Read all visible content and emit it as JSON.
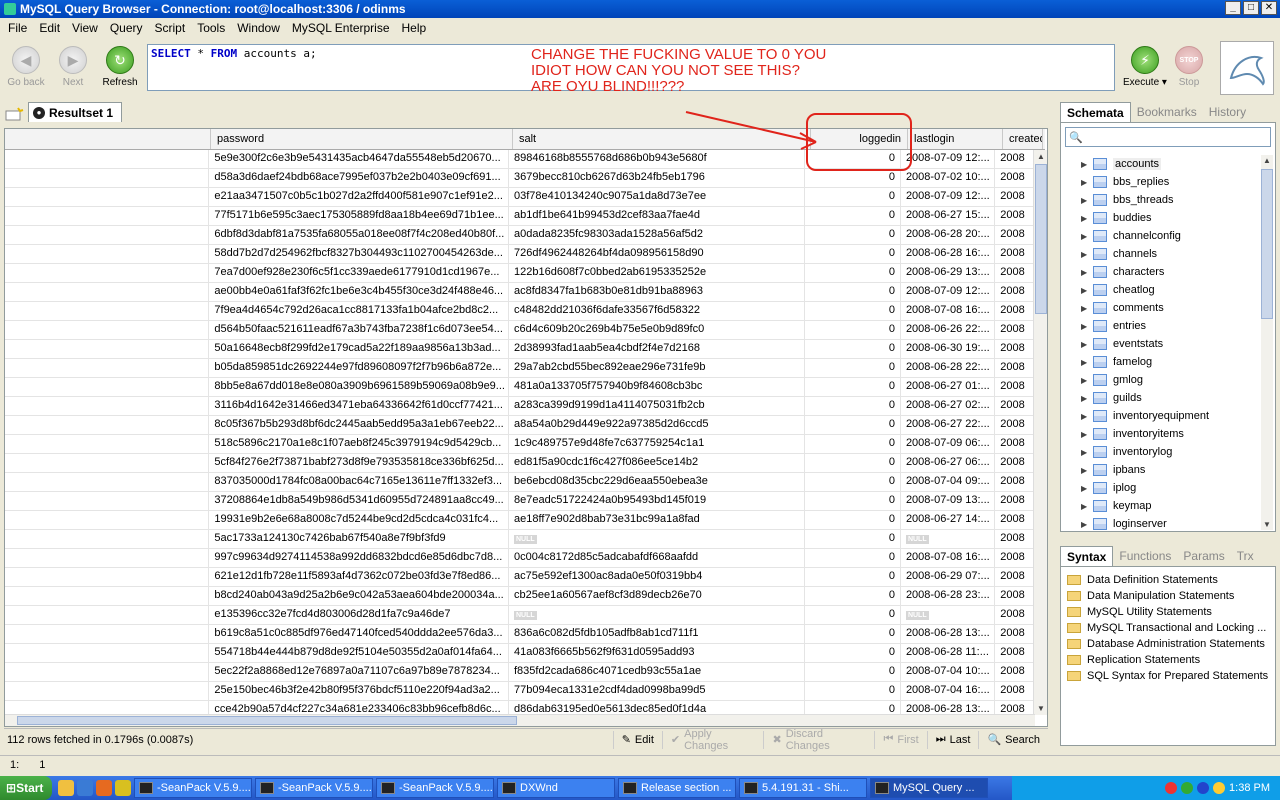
{
  "window": {
    "title": "MySQL Query Browser - Connection: root@localhost:3306 / odinms",
    "min": "_",
    "max": "□",
    "close": "✕"
  },
  "menu": [
    "File",
    "Edit",
    "View",
    "Query",
    "Script",
    "Tools",
    "Window",
    "MySQL Enterprise",
    "Help"
  ],
  "toolbar": {
    "goback": "Go back",
    "next": "Next",
    "refresh": "Refresh",
    "execute": "Execute",
    "stop": "Stop",
    "stop_icon_text": "STOP"
  },
  "query": {
    "kw1": "SELECT",
    "mid": " * ",
    "kw2": "FROM",
    "rest": " accounts a;"
  },
  "annotation": {
    "line1": "CHANGE THE FUCKING VALUE TO 0 YOU",
    "line2": "IDIOT HOW CAN YOU NOT SEE THIS?",
    "line3": "ARE OYU BLIND!!!???"
  },
  "result_tab": "Resultset 1",
  "columns": [
    "",
    "password",
    "salt",
    "loggedin",
    "lastlogin",
    "createda"
  ],
  "rows": [
    [
      "5e9e300f2c6e3b9e5431435acb4647da55548eb5d20670...",
      "89846168b8555768d686b0b943e5680f",
      "0",
      "2008-07-09 12:...",
      "2008"
    ],
    [
      "d58a3d6daef24bdb68ace7995ef037b2e2b0403e09cf691...",
      "3679becc810cb6267d63b24fb5eb1796",
      "0",
      "2008-07-02 10:...",
      "2008"
    ],
    [
      "e21aa3471507c0b5c1b027d2a2ffd400f581e907c1ef91e2...",
      "03f78e410134240c9075a1da8d73e7ee",
      "0",
      "2008-07-09 12:...",
      "2008"
    ],
    [
      "77f5171b6e595c3aec175305889fd8aa18b4ee69d71b1ee...",
      "ab1df1be641b99453d2cef83aa7fae4d",
      "0",
      "2008-06-27 15:...",
      "2008"
    ],
    [
      "6dbf8d3dabf81a7535fa68055a018ee08f7f4c208ed40b80f...",
      "a0dada8235fc98303ada1528a56af5d2",
      "0",
      "2008-06-28 20:...",
      "2008"
    ],
    [
      "58dd7b2d7d254962fbcf8327b304493c1102700454263de...",
      "726df4962448264bf4da098956158d90",
      "0",
      "2008-06-28 16:...",
      "2008"
    ],
    [
      "7ea7d00ef928e230f6c5f1cc339aede6177910d1cd1967e...",
      "122b16d608f7c0bbed2ab6195335252e",
      "0",
      "2008-06-29 13:...",
      "2008"
    ],
    [
      "ae00bb4e0a61faf3f62fc1be6e3c4b455f30ce3d24f488e46...",
      "ac8fd8347fa1b683b0e81db91ba88963",
      "0",
      "2008-07-09 12:...",
      "2008"
    ],
    [
      "7f9ea4d4654c792d26aca1cc8817133fa1b04afce2bd8c2...",
      "c48482dd21036f6dafe33567f6d58322",
      "0",
      "2008-07-08 16:...",
      "2008"
    ],
    [
      "d564b50faac521611eadf67a3b743fba7238f1c6d073ee54...",
      "c6d4c609b20c269b4b75e5e0b9d89fc0",
      "0",
      "2008-06-26 22:...",
      "2008"
    ],
    [
      "50a16648ecb8f299fd2e179cad5a22f189aa9856a13b3ad...",
      "2d38993fad1aab5ea4cbdf2f4e7d2168",
      "0",
      "2008-06-30 19:...",
      "2008"
    ],
    [
      "b05da859851dc2692244e97fd89608097f2f7b96b6a872e...",
      "29a7ab2cbd55bec892eae296e731fe9b",
      "0",
      "2008-06-28 22:...",
      "2008"
    ],
    [
      "8bb5e8a67dd018e8e080a3909b6961589b59069a08b9e9...",
      "481a0a133705f757940b9f84608cb3bc",
      "0",
      "2008-06-27 01:...",
      "2008"
    ],
    [
      "3116b4d1642e31466ed3471eba64336642f61d0ccf77421...",
      "a283ca399d9199d1a4114075031fb2cb",
      "0",
      "2008-06-27 02:...",
      "2008"
    ],
    [
      "8c05f367b5b293d8bf6dc2445aab5edd95a3a1eb67eeb22...",
      "a8a54a0b29d449e922a97385d2d6ccd5",
      "0",
      "2008-06-27 22:...",
      "2008"
    ],
    [
      "518c5896c2170a1e8c1f07aeb8f245c3979194c9d5429cb...",
      "1c9c489757e9d48fe7c637759254c1a1",
      "0",
      "2008-07-09 06:...",
      "2008"
    ],
    [
      "5cf84f276e2f73871babf273d8f9e793535818ce336bf625d...",
      "ed81f5a90cdc1f6c427f086ee5ce14b2",
      "0",
      "2008-06-27 06:...",
      "2008"
    ],
    [
      "837035000d1784fc08a00bac64c7165e13611e7ff1332ef3...",
      "be6ebcd08d35cbc229d6eaa550ebea3e",
      "0",
      "2008-07-04 09:...",
      "2008"
    ],
    [
      "37208864e1db8a549b986d5341d60955d724891aa8cc49...",
      "8e7eadc51722424a0b95493bd145f019",
      "0",
      "2008-07-09 13:...",
      "2008"
    ],
    [
      "19931e9b2e6e68a8008c7d5244be9cd2d5cdca4c031fc4...",
      "ae18ff7e902d8bab73e31bc99a1a8fad",
      "0",
      "2008-06-27 14:...",
      "2008"
    ],
    [
      "5ac1733a124130c7426bab67f540a8e7f9bf3fd9",
      "NULL",
      "0",
      "NULL",
      "2008"
    ],
    [
      "997c99634d9274114538a992dd6832bdcd6e85d6dbc7d8...",
      "0c004c8172d85c5adcabafdf668aafdd",
      "0",
      "2008-07-08 16:...",
      "2008"
    ],
    [
      "621e12d1fb728e11f5893af4d7362c072be03fd3e7f8ed86...",
      "ac75e592ef1300ac8ada0e50f0319bb4",
      "0",
      "2008-06-29 07:...",
      "2008"
    ],
    [
      "b8cd240ab043a9d25a2b6e9c042a53aea604bde200034a...",
      "cb25ee1a60567aef8cf3d89decb26e70",
      "0",
      "2008-06-28 23:...",
      "2008"
    ],
    [
      "e135396cc32e7fcd4d803006d28d1fa7c9a46de7",
      "NULL",
      "0",
      "NULL",
      "2008"
    ],
    [
      "b619c8a51c0c885df976ed47140fced540ddda2ee576da3...",
      "836a6c082d5fdb105adfb8ab1cd711f1",
      "0",
      "2008-06-28 13:...",
      "2008"
    ],
    [
      "554718b44e444b879d8de92f5104e50355d2a0af014fa64...",
      "41a083f6665b562f9f631d0595add93",
      "0",
      "2008-06-28 11:...",
      "2008"
    ],
    [
      "5ec22f2a8868ed12e76897a0a71107c6a97b89e7878234...",
      "f835fd2cada686c4071cedb93c55a1ae",
      "0",
      "2008-07-04 10:...",
      "2008"
    ],
    [
      "25e150bec46b3f2e42b80f95f376bdcf5110e220f94ad3a2...",
      "77b094eca1331e2cdf4dad0998ba99d5",
      "0",
      "2008-07-04 16:...",
      "2008"
    ],
    [
      "cce42b90a57d4cf227c34a681e233406c83bb96cefb8d6c...",
      "d86dab63195ed0e5613dec85ed0f1d4a",
      "0",
      "2008-06-28 13:...",
      "2008"
    ]
  ],
  "status": {
    "message": "112 rows fetched in 0.1796s (0.0087s)",
    "edit": "Edit",
    "apply": "Apply Changes",
    "discard": "Discard Changes",
    "first": "First",
    "last": "Last",
    "search": "Search",
    "line": "1:",
    "col": "1"
  },
  "schemata_tabs": [
    "Schemata",
    "Bookmarks",
    "History"
  ],
  "tables": [
    "accounts",
    "bbs_replies",
    "bbs_threads",
    "buddies",
    "channelconfig",
    "channels",
    "characters",
    "cheatlog",
    "comments",
    "entries",
    "eventstats",
    "famelog",
    "gmlog",
    "guilds",
    "inventoryequipment",
    "inventoryitems",
    "inventorylog",
    "ipbans",
    "iplog",
    "keymap",
    "loginserver"
  ],
  "syntax_tabs": [
    "Syntax",
    "Functions",
    "Params",
    "Trx"
  ],
  "syntax_items": [
    "Data Definition Statements",
    "Data Manipulation Statements",
    "MySQL Utility Statements",
    "MySQL Transactional and Locking ...",
    "Database Administration Statements",
    "Replication Statements",
    "SQL Syntax for Prepared Statements"
  ],
  "taskbar": {
    "start": "Start",
    "tasks": [
      "-SeanPack V.5.9....",
      "-SeanPack V.5.9....",
      "-SeanPack V.5.9....",
      "DXWnd",
      "Release section ...",
      "5.4.191.31 - Shi...",
      "MySQL Query ..."
    ],
    "clock": "1:38 PM"
  },
  "colors": {
    "annotation": "#e0241b",
    "keyword": "#0000c8"
  }
}
